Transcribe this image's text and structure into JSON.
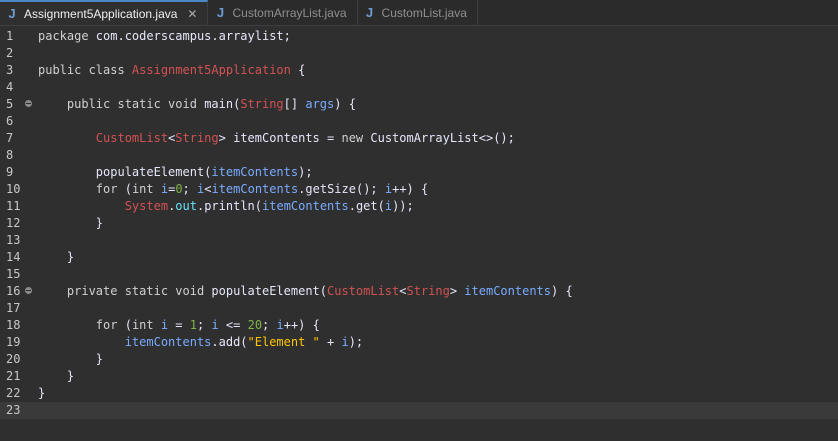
{
  "tabs": [
    {
      "label": "Assignment5Application.java",
      "active": true,
      "closable": true
    },
    {
      "label": "CustomArrayList.java",
      "active": false,
      "closable": false
    },
    {
      "label": "CustomList.java",
      "active": false,
      "closable": false
    }
  ],
  "colors": {
    "background": "#2f2f2f",
    "keyword": "#d0d0d0",
    "class_name": "#d25252",
    "variable": "#79abff",
    "string": "#ffc600",
    "number": "#7fb347"
  },
  "editor": {
    "current_line": 23,
    "lines": [
      {
        "n": "1",
        "fold": false,
        "tokens": [
          [
            "kw2",
            "package "
          ],
          [
            "plain",
            "com.coderscampus.arraylist;"
          ]
        ]
      },
      {
        "n": "2",
        "fold": false,
        "tokens": []
      },
      {
        "n": "3",
        "fold": false,
        "tokens": [
          [
            "kw2",
            "public class "
          ],
          [
            "cls",
            "Assignment5Application"
          ],
          [
            "plain",
            " {"
          ]
        ]
      },
      {
        "n": "4",
        "fold": false,
        "tokens": []
      },
      {
        "n": "5",
        "fold": true,
        "tokens": [
          [
            "plain",
            "    "
          ],
          [
            "kw2",
            "public static void "
          ],
          [
            "plain",
            "main("
          ],
          [
            "cls",
            "String"
          ],
          [
            "plain",
            "[] "
          ],
          [
            "var",
            "args"
          ],
          [
            "plain",
            ") {"
          ]
        ]
      },
      {
        "n": "6",
        "fold": false,
        "tokens": []
      },
      {
        "n": "7",
        "fold": false,
        "tokens": [
          [
            "plain",
            "        "
          ],
          [
            "typ",
            "CustomList"
          ],
          [
            "plain",
            "<"
          ],
          [
            "typ",
            "String"
          ],
          [
            "plain",
            "> itemContents = "
          ],
          [
            "kw2",
            "new "
          ],
          [
            "plain",
            "CustomArrayList<>();"
          ]
        ]
      },
      {
        "n": "8",
        "fold": false,
        "tokens": []
      },
      {
        "n": "9",
        "fold": false,
        "tokens": [
          [
            "plain",
            "        populateElement("
          ],
          [
            "var",
            "itemContents"
          ],
          [
            "plain",
            ");"
          ]
        ]
      },
      {
        "n": "10",
        "fold": false,
        "tokens": [
          [
            "plain",
            "        "
          ],
          [
            "kw2",
            "for "
          ],
          [
            "plain",
            "("
          ],
          [
            "kw2",
            "int "
          ],
          [
            "var",
            "i"
          ],
          [
            "plain",
            "="
          ],
          [
            "num",
            "0"
          ],
          [
            "plain",
            "; "
          ],
          [
            "var",
            "i"
          ],
          [
            "plain",
            "<"
          ],
          [
            "var",
            "itemContents"
          ],
          [
            "plain",
            ".getSize(); "
          ],
          [
            "var",
            "i"
          ],
          [
            "plain",
            "++) {"
          ]
        ]
      },
      {
        "n": "11",
        "fold": false,
        "tokens": [
          [
            "plain",
            "            "
          ],
          [
            "cls",
            "System"
          ],
          [
            "plain",
            "."
          ],
          [
            "fld",
            "out"
          ],
          [
            "plain",
            ".println("
          ],
          [
            "var",
            "itemContents"
          ],
          [
            "plain",
            ".get("
          ],
          [
            "var",
            "i"
          ],
          [
            "plain",
            "));"
          ]
        ]
      },
      {
        "n": "12",
        "fold": false,
        "tokens": [
          [
            "plain",
            "        }"
          ]
        ]
      },
      {
        "n": "13",
        "fold": false,
        "tokens": []
      },
      {
        "n": "14",
        "fold": false,
        "tokens": [
          [
            "plain",
            "    }"
          ]
        ]
      },
      {
        "n": "15",
        "fold": false,
        "tokens": []
      },
      {
        "n": "16",
        "fold": true,
        "tokens": [
          [
            "plain",
            "    "
          ],
          [
            "kw2",
            "private static void "
          ],
          [
            "plain",
            "populateElement("
          ],
          [
            "typ",
            "CustomList"
          ],
          [
            "plain",
            "<"
          ],
          [
            "typ",
            "String"
          ],
          [
            "plain",
            "> "
          ],
          [
            "var",
            "itemContents"
          ],
          [
            "plain",
            ") {"
          ]
        ]
      },
      {
        "n": "17",
        "fold": false,
        "tokens": []
      },
      {
        "n": "18",
        "fold": false,
        "tokens": [
          [
            "plain",
            "        "
          ],
          [
            "kw2",
            "for "
          ],
          [
            "plain",
            "("
          ],
          [
            "kw2",
            "int "
          ],
          [
            "var",
            "i"
          ],
          [
            "plain",
            " = "
          ],
          [
            "num",
            "1"
          ],
          [
            "plain",
            "; "
          ],
          [
            "var",
            "i"
          ],
          [
            "plain",
            " <= "
          ],
          [
            "num",
            "20"
          ],
          [
            "plain",
            "; "
          ],
          [
            "var",
            "i"
          ],
          [
            "plain",
            "++) {"
          ]
        ]
      },
      {
        "n": "19",
        "fold": false,
        "tokens": [
          [
            "plain",
            "            "
          ],
          [
            "var",
            "itemContents"
          ],
          [
            "plain",
            ".add("
          ],
          [
            "str",
            "\"Element \""
          ],
          [
            "plain",
            " + "
          ],
          [
            "var",
            "i"
          ],
          [
            "plain",
            ");"
          ]
        ]
      },
      {
        "n": "20",
        "fold": false,
        "tokens": [
          [
            "plain",
            "        }"
          ]
        ]
      },
      {
        "n": "21",
        "fold": false,
        "tokens": [
          [
            "plain",
            "    }"
          ]
        ]
      },
      {
        "n": "22",
        "fold": false,
        "tokens": [
          [
            "plain",
            "}"
          ]
        ]
      },
      {
        "n": "23",
        "fold": false,
        "tokens": []
      }
    ]
  }
}
